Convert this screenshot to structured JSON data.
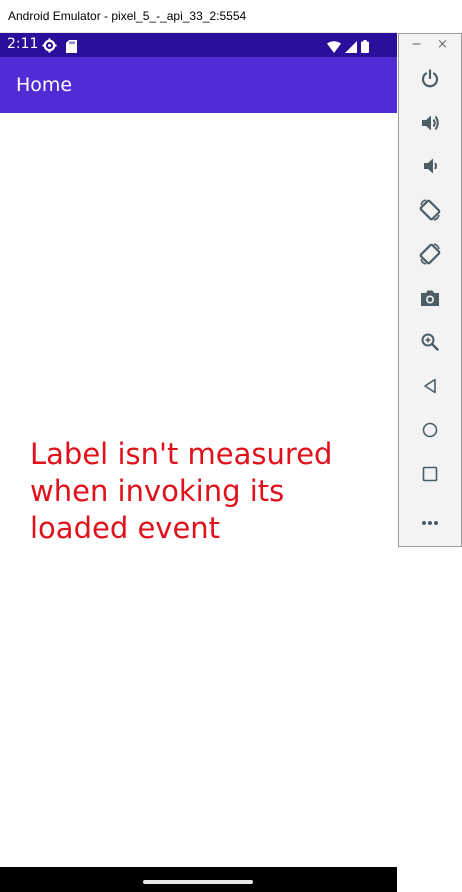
{
  "window": {
    "title": "Android Emulator - pixel_5_-_api_33_2:5554"
  },
  "status_bar": {
    "time": "2:11",
    "background": "#2a0f9a"
  },
  "app_bar": {
    "title": "Home",
    "background": "#512bd4"
  },
  "content": {
    "label_text": "Label isn't measured when invoking its loaded event",
    "label_color": "#e0111b"
  },
  "toolbar": {
    "minimize_label": "−",
    "close_label": "×",
    "buttons": [
      {
        "name": "power-icon"
      },
      {
        "name": "volume-up-icon"
      },
      {
        "name": "volume-down-icon"
      },
      {
        "name": "rotate-left-icon"
      },
      {
        "name": "rotate-right-icon"
      },
      {
        "name": "camera-icon"
      },
      {
        "name": "zoom-icon"
      },
      {
        "name": "back-icon"
      },
      {
        "name": "home-icon"
      },
      {
        "name": "overview-icon"
      },
      {
        "name": "more-icon"
      }
    ]
  }
}
